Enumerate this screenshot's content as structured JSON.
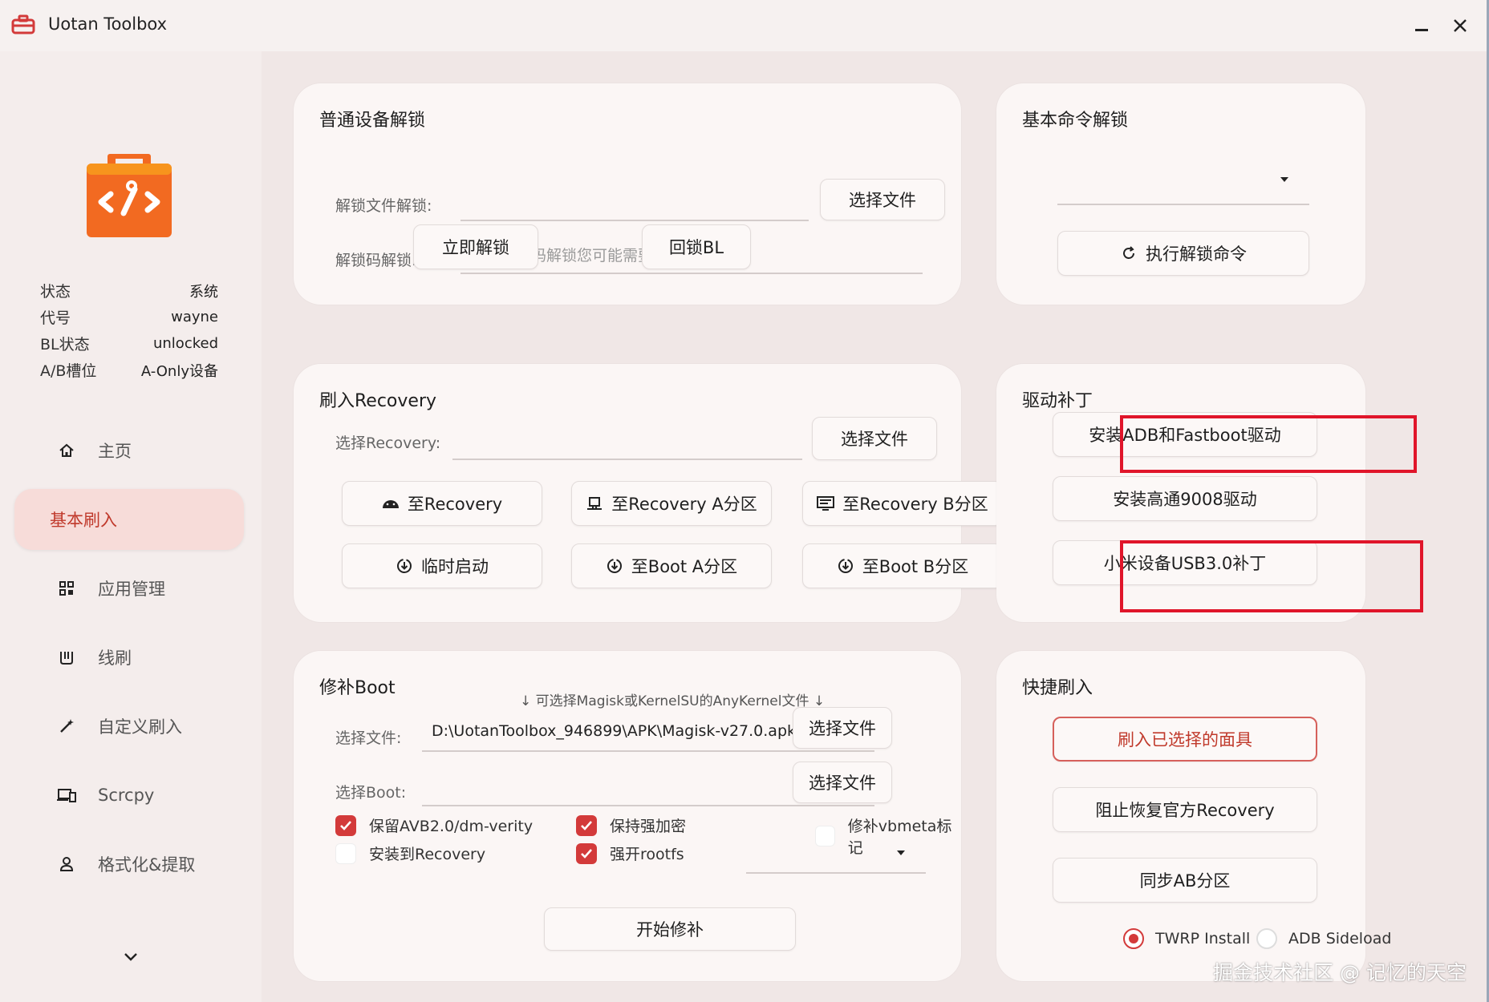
{
  "window": {
    "title": "Uotan Toolbox"
  },
  "status": [
    {
      "key": "状态",
      "value": "系统"
    },
    {
      "key": "代号",
      "value": "wayne"
    },
    {
      "key": "BL状态",
      "value": "unlocked"
    },
    {
      "key": "A/B槽位",
      "value": "A-Only设备"
    }
  ],
  "nav": {
    "items": [
      {
        "label": "主页",
        "icon": "home-icon"
      },
      {
        "label": "基本刷入",
        "icon": "",
        "active": true
      },
      {
        "label": "应用管理",
        "icon": "apps-grid-icon"
      },
      {
        "label": "线刷",
        "icon": "flash-line-icon"
      },
      {
        "label": "自定义刷入",
        "icon": "magic-wand-icon"
      },
      {
        "label": "Scrcpy",
        "icon": "devices-icon"
      },
      {
        "label": "格式化&提取",
        "icon": "user-extract-icon"
      }
    ]
  },
  "unlock": {
    "title": "普通设备解锁",
    "file_label": "解锁文件解锁:",
    "file_value": "",
    "select_file": "选择文件",
    "code_label": "解锁码解锁:",
    "code_placeholder": "使用解锁码解锁您可能需要自行添加“0x”",
    "unlock_now": "立即解锁",
    "relock": "回锁BL"
  },
  "cmd_unlock": {
    "title": "基本命令解锁",
    "selected": "",
    "execute": "执行解锁命令"
  },
  "recovery": {
    "title": "刷入Recovery",
    "label": "选择Recovery:",
    "value": "",
    "select_file": "选择文件",
    "buttons": [
      "至Recovery",
      "至Recovery A分区",
      "至Recovery B分区",
      "临时启动",
      "至Boot A分区",
      "至Boot B分区"
    ]
  },
  "driver": {
    "title": "驱动补丁",
    "adb_fastboot": "安装ADB和Fastboot驱动",
    "qualcomm": "安装高通9008驱动",
    "xiaomi_usb": "小米设备USB3.0补丁"
  },
  "patch_boot": {
    "title": "修补Boot",
    "hint": "↓ 可选择Magisk或KernelSU的AnyKernel文件 ↓",
    "file_label": "选择文件:",
    "file_value": "D:\\UotanToolbox_946899\\APK\\Magisk-v27.0.apk",
    "select_file": "选择文件",
    "boot_label": "选择Boot:",
    "boot_value": "",
    "select_boot": "选择文件",
    "options": [
      {
        "label": "保留AVB2.0/dm-verity",
        "checked": true
      },
      {
        "label": "保持强加密",
        "checked": true
      },
      {
        "label": "修补vbmeta标记",
        "checked": false
      },
      {
        "label": "安装到Recovery",
        "checked": false
      },
      {
        "label": "强开rootfs",
        "checked": true
      }
    ],
    "arch_selected": "",
    "start": "开始修补"
  },
  "quick": {
    "title": "快捷刷入",
    "flash_selected": "刷入已选择的面具",
    "block_recovery": "阻止恢复官方Recovery",
    "sync_ab": "同步AB分区",
    "radio": [
      {
        "label": "TWRP Install",
        "checked": true
      },
      {
        "label": "ADB Sideload",
        "checked": false
      }
    ]
  },
  "watermark": "掘金技术社区 @ 记忆的天空",
  "colors": {
    "accent": "#d33a3a",
    "highlight": "#e0152a",
    "logo": "#f26a21"
  }
}
